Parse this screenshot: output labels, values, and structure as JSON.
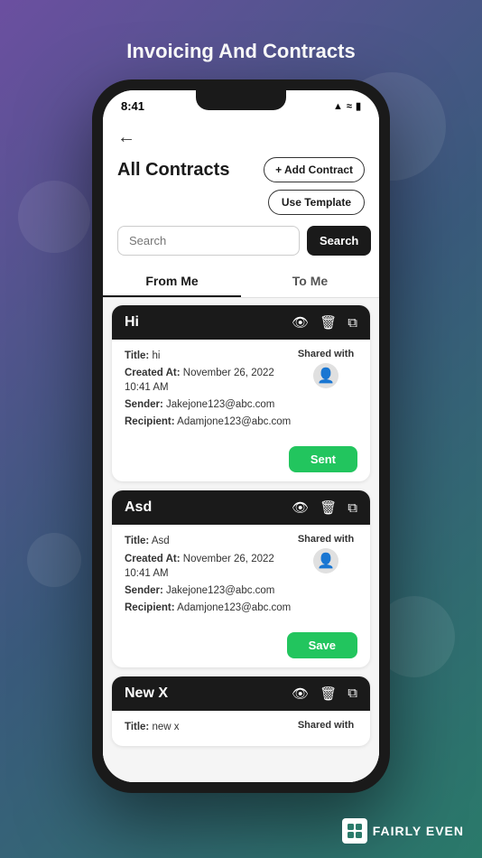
{
  "page": {
    "title": "Invoicing And Contracts",
    "background": "linear-gradient(135deg, #6b4fa0 0%, #3a5a7c 50%, #2a7a6a 100%)"
  },
  "status_bar": {
    "time": "8:41",
    "icons": [
      "signal",
      "wifi",
      "battery"
    ]
  },
  "header": {
    "back_label": "←",
    "title": "All Contracts",
    "add_button": "+ Add Contract",
    "use_template_button": "Use Template"
  },
  "search": {
    "placeholder": "Search",
    "button_label": "Search"
  },
  "tabs": [
    {
      "label": "From Me",
      "active": true
    },
    {
      "label": "To Me",
      "active": false
    }
  ],
  "contracts": [
    {
      "id": "hi",
      "title": "Hi",
      "details": {
        "title_label": "Title:",
        "title_value": "hi",
        "created_label": "Created At:",
        "created_value": "November 26, 2022 10:41 AM",
        "sender_label": "Sender:",
        "sender_value": "Jakejone123@abc.com",
        "recipient_label": "Recipient:",
        "recipient_value": "Adamjone123@abc.com"
      },
      "shared_with_label": "Shared with",
      "action_button": "Sent",
      "action_type": "sent"
    },
    {
      "id": "asd",
      "title": "Asd",
      "details": {
        "title_label": "Title:",
        "title_value": "Asd",
        "created_label": "Created At:",
        "created_value": "November 26, 2022 10:41 AM",
        "sender_label": "Sender:",
        "sender_value": "Jakejone123@abc.com",
        "recipient_label": "Recipient:",
        "recipient_value": "Adamjone123@abc.com"
      },
      "shared_with_label": "Shared with",
      "action_button": "Save",
      "action_type": "save"
    },
    {
      "id": "new-x",
      "title": "New X",
      "details": {
        "title_label": "Title:",
        "title_value": "new x",
        "created_label": "",
        "created_value": "",
        "sender_label": "",
        "sender_value": "",
        "recipient_label": "",
        "recipient_value": ""
      },
      "shared_with_label": "Shared with",
      "action_button": "",
      "action_type": ""
    }
  ],
  "logo": {
    "icon": "FE",
    "text": "FAIRLY EVEN"
  }
}
